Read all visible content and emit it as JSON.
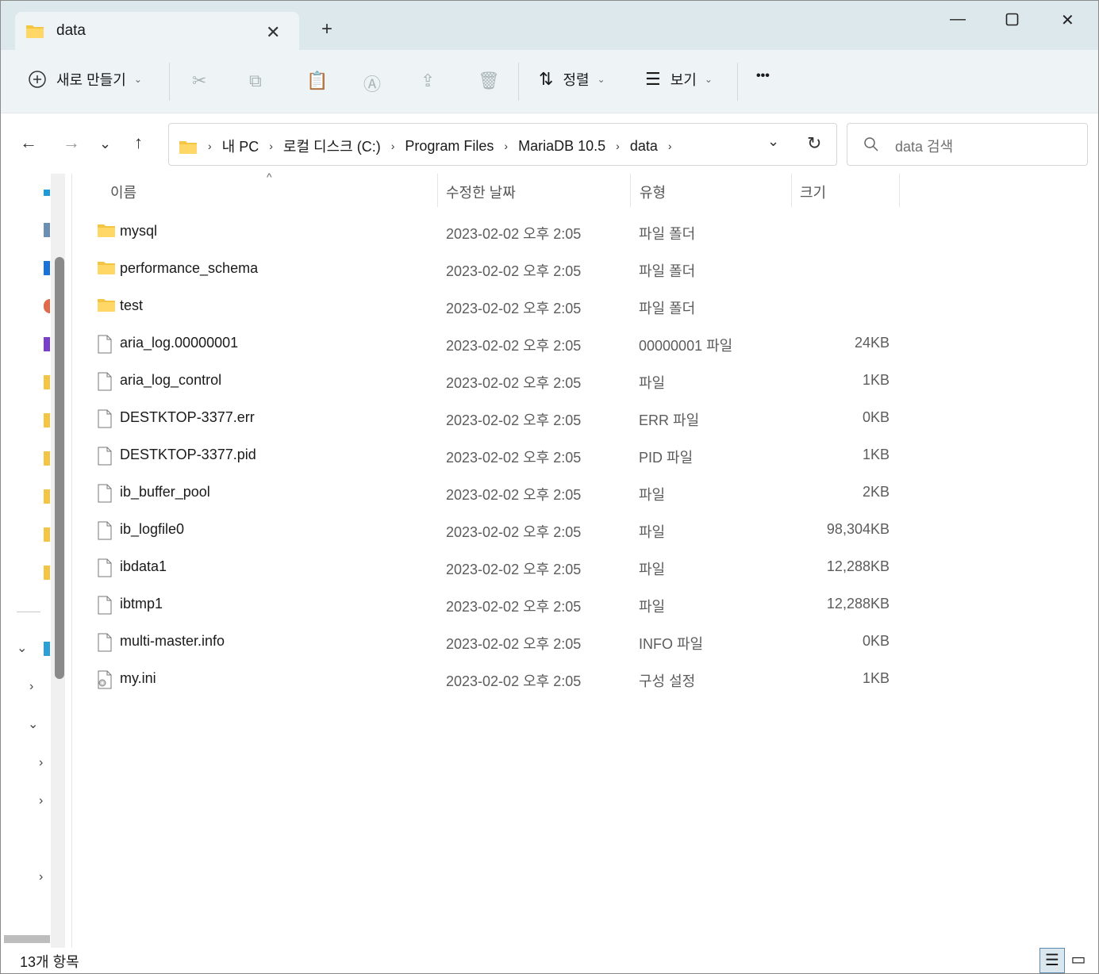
{
  "window": {
    "tab_title": "data",
    "new_tab_symbol": "+",
    "minimize_symbol": "—",
    "maximize_symbol": "☐",
    "close_symbol": "✕"
  },
  "toolbar": {
    "new_label": "새로 만들기",
    "sort_label": "정렬",
    "view_label": "보기",
    "more_symbol": "•••"
  },
  "address": {
    "crumbs": [
      "내 PC",
      "로컬 디스크 (C:)",
      "Program Files",
      "MariaDB 10.5",
      "data"
    ],
    "search_placeholder": "data 검색"
  },
  "columns": {
    "name": "이름",
    "modified": "수정한 날짜",
    "type": "유형",
    "size": "크기"
  },
  "files": [
    {
      "name": "mysql",
      "modified": "2023-02-02 오후 2:05",
      "type": "파일 폴더",
      "size": "",
      "icon": "folder-icon"
    },
    {
      "name": "performance_schema",
      "modified": "2023-02-02 오후 2:05",
      "type": "파일 폴더",
      "size": "",
      "icon": "folder-icon"
    },
    {
      "name": "test",
      "modified": "2023-02-02 오후 2:05",
      "type": "파일 폴더",
      "size": "",
      "icon": "folder-icon"
    },
    {
      "name": "aria_log.00000001",
      "modified": "2023-02-02 오후 2:05",
      "type": "00000001 파일",
      "size": "24KB",
      "icon": "file-icon"
    },
    {
      "name": "aria_log_control",
      "modified": "2023-02-02 오후 2:05",
      "type": "파일",
      "size": "1KB",
      "icon": "file-icon"
    },
    {
      "name": "DESTKTOP-3377.err",
      "modified": "2023-02-02 오후 2:05",
      "type": "ERR 파일",
      "size": "0KB",
      "icon": "file-icon"
    },
    {
      "name": "DESTKTOP-3377.pid",
      "modified": "2023-02-02 오후 2:05",
      "type": "PID 파일",
      "size": "1KB",
      "icon": "file-icon"
    },
    {
      "name": "ib_buffer_pool",
      "modified": "2023-02-02 오후 2:05",
      "type": "파일",
      "size": "2KB",
      "icon": "file-icon"
    },
    {
      "name": "ib_logfile0",
      "modified": "2023-02-02 오후 2:05",
      "type": "파일",
      "size": "98,304KB",
      "icon": "file-icon"
    },
    {
      "name": "ibdata1",
      "modified": "2023-02-02 오후 2:05",
      "type": "파일",
      "size": "12,288KB",
      "icon": "file-icon"
    },
    {
      "name": "ibtmp1",
      "modified": "2023-02-02 오후 2:05",
      "type": "파일",
      "size": "12,288KB",
      "icon": "file-icon"
    },
    {
      "name": "multi-master.info",
      "modified": "2023-02-02 오후 2:05",
      "type": "INFO 파일",
      "size": "0KB",
      "icon": "file-icon"
    },
    {
      "name": "my.ini",
      "modified": "2023-02-02 오후 2:05",
      "type": "구성 설정",
      "size": "1KB",
      "icon": "config-file-icon"
    }
  ],
  "status": {
    "item_count": "13개 항목"
  },
  "colors": {
    "titlebar_bg": "#dde8ec",
    "toolbar_bg": "#eef4f6",
    "folder_yellow": "#f4c542",
    "view_active_border": "#5b8bb0"
  }
}
